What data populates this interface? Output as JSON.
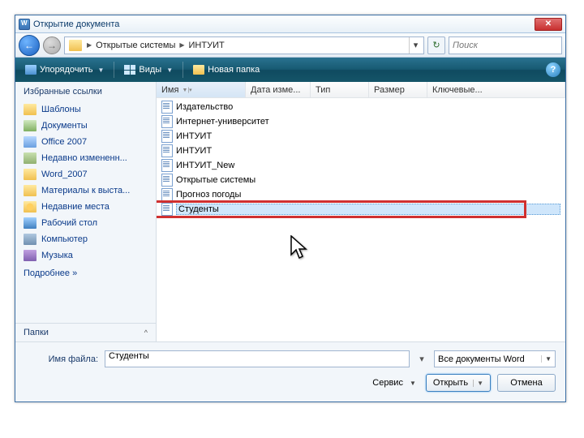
{
  "title": "Открытие документа",
  "breadcrumb": {
    "items": [
      "Открытые системы",
      "ИНТУИТ"
    ]
  },
  "search": {
    "placeholder": "Поиск"
  },
  "toolbar": {
    "organize": "Упорядочить",
    "views": "Виды",
    "newfolder": "Новая папка"
  },
  "sidebar": {
    "header": "Избранные ссылки",
    "items": [
      {
        "label": "Шаблоны",
        "icon": "ic-folder"
      },
      {
        "label": "Документы",
        "icon": "ic-docs"
      },
      {
        "label": "Office 2007",
        "icon": "ic-folder-blue"
      },
      {
        "label": "Недавно измененн...",
        "icon": "ic-recent"
      },
      {
        "label": "Word_2007",
        "icon": "ic-folder"
      },
      {
        "label": "Материалы к выста...",
        "icon": "ic-folder"
      },
      {
        "label": "Недавние места",
        "icon": "ic-star"
      },
      {
        "label": "Рабочий стол",
        "icon": "ic-desktop"
      },
      {
        "label": "Компьютер",
        "icon": "ic-computer"
      },
      {
        "label": "Музыка",
        "icon": "ic-music"
      }
    ],
    "more": "Подробнее  »",
    "footer": "Папки"
  },
  "columns": {
    "name": "Имя",
    "date": "Дата изме...",
    "type": "Тип",
    "size": "Размер",
    "key": "Ключевые..."
  },
  "files": [
    "Издательство",
    "Интернет-университет",
    "ИНТУИТ",
    "ИНТУИТ",
    "ИНТУИТ_New",
    "Открытые системы",
    "Прогноз погоды",
    "Студенты"
  ],
  "selected_index": 7,
  "footer": {
    "filename_label": "Имя файла:",
    "filename_value": "Студенты",
    "filter": "Все документы Word",
    "tools": "Сервис",
    "open": "Открыть",
    "cancel": "Отмена"
  }
}
